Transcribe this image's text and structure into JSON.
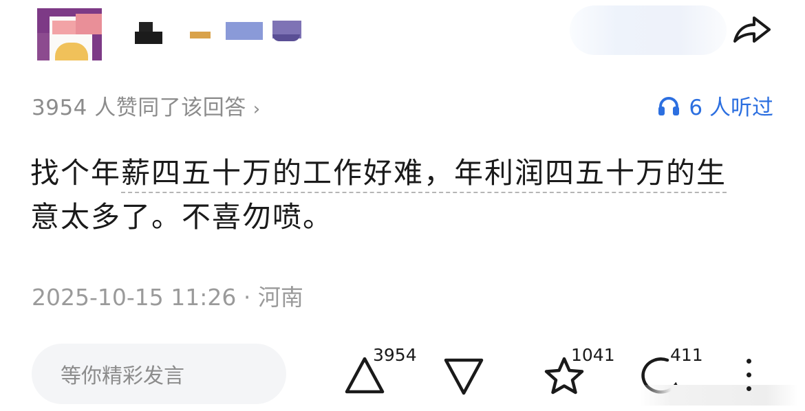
{
  "header": {
    "avatar_icon": "user-avatar-pixelated",
    "username_redacted": true,
    "share_icon": "share-arrow-icon"
  },
  "meta": {
    "likes_text": "3954 人赞同了该回答",
    "likes_chevron": "›",
    "listened_icon": "headphones-icon",
    "listened_text": "6 人听过",
    "accent_color": "#2c6fe0"
  },
  "answer": {
    "part1": "找个年",
    "part2_link": "薪四五十万的工作好难，年利润四五十万的生",
    "part3": "意太多了。不喜勿喷。"
  },
  "footer": {
    "timestamp_location": "2025-10-15 11:26 · 河南"
  },
  "actions": {
    "comment_placeholder": "等你精彩发言",
    "upvote_icon": "triangle-up-icon",
    "upvote_count": "3954",
    "downvote_icon": "triangle-down-icon",
    "favorite_icon": "star-icon",
    "favorite_count": "1041",
    "comment_icon": "comment-bubble-icon",
    "comment_count": "411",
    "more_icon": "more-vertical-icon"
  }
}
